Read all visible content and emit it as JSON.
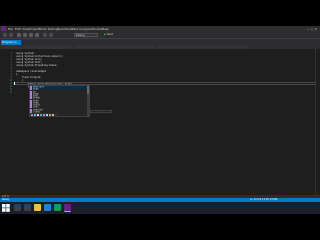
{
  "menu": [
    "File",
    "Edit",
    "View",
    "Project",
    "Build",
    "Debug",
    "Team",
    "Tools",
    "Test",
    "Analyze",
    "Window",
    "Help"
  ],
  "window_title": "",
  "toolbar": {
    "config": "Debug",
    "run_label": "Start"
  },
  "tabs": [
    {
      "label": "Program.cs"
    }
  ],
  "nav": {
    "left": "",
    "middle": "",
    "right": ""
  },
  "code_lines": [
    {
      "n": "1",
      "text": "using System;"
    },
    {
      "n": "2",
      "text": "using System.Collections.Generic;"
    },
    {
      "n": "3",
      "text": "using System.Linq;"
    },
    {
      "n": "4",
      "text": "using System.Text;"
    },
    {
      "n": "5",
      "text": "using System.Threading.Tasks;"
    },
    {
      "n": "6",
      "text": ""
    },
    {
      "n": "7",
      "text": "namespace ConsoleApp1"
    },
    {
      "n": "8",
      "text": "{"
    },
    {
      "n": "9",
      "text": "    class Program"
    },
    {
      "n": "10",
      "text": "    {"
    },
    {
      "n": "11",
      "text": "        static void Main(string[] args)"
    },
    {
      "n": "12",
      "text": "        {"
    },
    {
      "n": "13",
      "text": ""
    },
    {
      "n": "14",
      "text": ""
    }
  ],
  "popup_items": [
    "abstract",
    "args",
    "as",
    "base",
    "bool",
    "break",
    "byte",
    "case",
    "catch",
    "char",
    "checked",
    "class"
  ],
  "tooltip": "",
  "statusbar": {
    "left": "Ready",
    "right": "Ln 13  Col 13  Ch 13  INS"
  },
  "zoom": "100 %",
  "taskbar": {
    "time": "",
    "date": ""
  },
  "colors": {
    "accent": "#007acc",
    "editor_bg": "#1e1e1e",
    "chrome": "#2d2d30",
    "taskbar": "#1b1f2a"
  }
}
